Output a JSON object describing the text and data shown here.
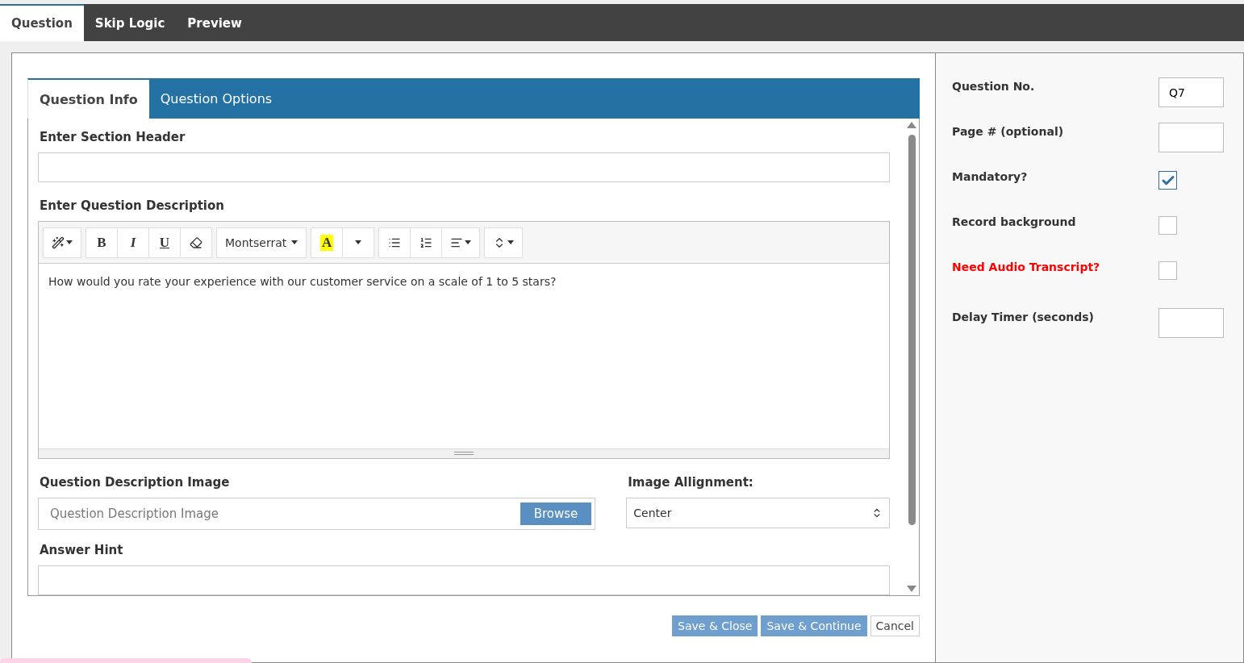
{
  "top_tabs": [
    {
      "label": "Question",
      "selected": true
    },
    {
      "label": "Skip Logic",
      "selected": false
    },
    {
      "label": "Preview",
      "selected": false
    }
  ],
  "inner_tabs": [
    {
      "label": "Question Info",
      "selected": true
    },
    {
      "label": "Question Options",
      "selected": false
    }
  ],
  "section_header": {
    "label": "Enter Section Header"
  },
  "description": {
    "label": "Enter Question Description",
    "toolbar": {
      "format_glyphs": [
        "B",
        "I",
        "U"
      ],
      "font": "Montserrat",
      "color_glyph": "A"
    },
    "text": "How would you rate your experience with our customer service on a scale of 1 to 5 stars?"
  },
  "image": {
    "label": "Question Description Image",
    "placeholder": "Question Description Image",
    "button": "Browse"
  },
  "alignment": {
    "label": "Image Allignment:",
    "value": "Center"
  },
  "answer_hint": {
    "label": "Answer Hint"
  },
  "actions": [
    {
      "label": "Save & Close",
      "kind": "primary"
    },
    {
      "label": "Save & Continue",
      "kind": "primary"
    },
    {
      "label": "Cancel",
      "kind": "default"
    }
  ],
  "settings": [
    {
      "kind": "text",
      "label": "Question No.",
      "value": "Q7",
      "color": "#333333"
    },
    {
      "kind": "text",
      "label": "Page # (optional)",
      "color": "#333333"
    },
    {
      "kind": "checkbox",
      "label": "Mandatory?",
      "checked": true,
      "color": "#333333"
    },
    {
      "kind": "checkbox",
      "label": "Record background",
      "checked": false,
      "color": "#333333"
    },
    {
      "kind": "checkbox",
      "label": "Need Audio Transcript?",
      "checked": false,
      "color": "#ff0000"
    },
    {
      "kind": "text",
      "label": "Delay Timer (seconds)",
      "color": "#333333"
    }
  ]
}
